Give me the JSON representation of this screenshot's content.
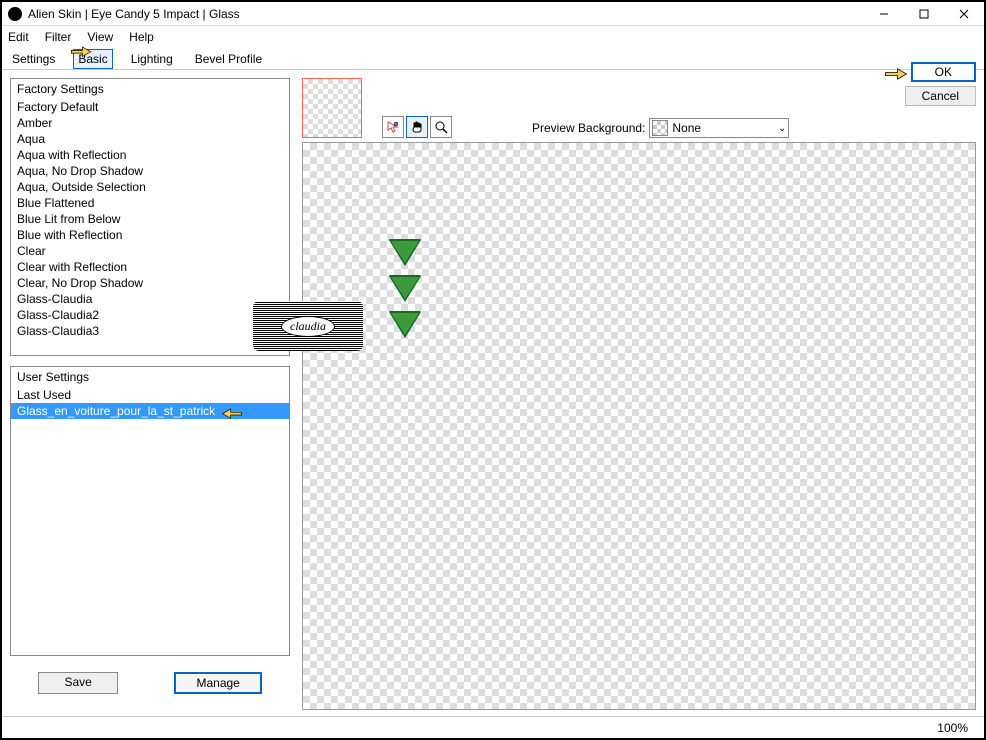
{
  "window": {
    "title": "Alien Skin | Eye Candy 5 Impact | Glass"
  },
  "menu": {
    "edit": "Edit",
    "filter": "Filter",
    "view": "View",
    "help": "Help"
  },
  "tabs": {
    "settings": "Settings",
    "basic": "Basic",
    "lighting": "Lighting",
    "bevel": "Bevel Profile"
  },
  "factory": {
    "header": "Factory Settings",
    "items": [
      "Factory Default",
      "Amber",
      "Aqua",
      "Aqua with Reflection",
      "Aqua, No Drop Shadow",
      "Aqua, Outside Selection",
      "Blue Flattened",
      "Blue Lit from Below",
      "Blue with Reflection",
      "Clear",
      "Clear with Reflection",
      "Clear, No Drop Shadow",
      "Glass-Claudia",
      "Glass-Claudia2",
      "Glass-Claudia3"
    ]
  },
  "user": {
    "header": "User Settings",
    "items": [
      "Last Used",
      "Glass_en_voiture_pour_la_st_patrick"
    ],
    "selected_index": 1
  },
  "buttons": {
    "save": "Save",
    "manage": "Manage",
    "ok": "OK",
    "cancel": "Cancel"
  },
  "preview_bg": {
    "label": "Preview Background:",
    "value": "None"
  },
  "status": {
    "zoom": "100%"
  },
  "watermark": {
    "text": "claudia"
  }
}
